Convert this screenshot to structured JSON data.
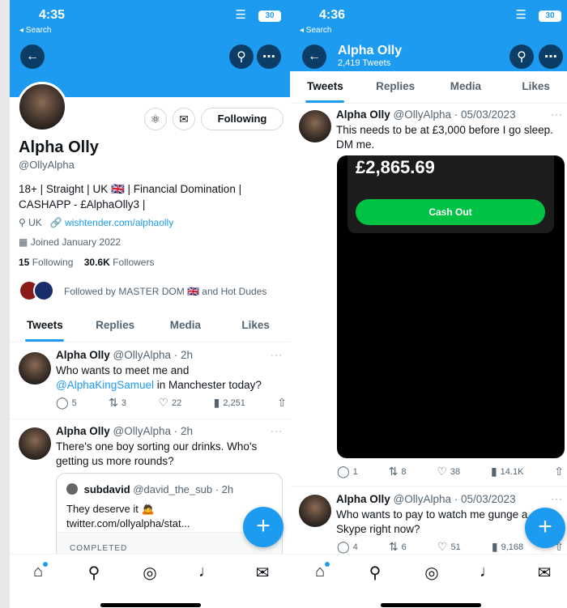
{
  "colors": {
    "brand": "#1d9bf0",
    "cash_green": "#00c244"
  },
  "left": {
    "status": {
      "time": "4:35",
      "back_app": "◂ Search",
      "battery": "30"
    },
    "profile": {
      "name": "Alpha Olly",
      "handle": "@OllyAlpha",
      "follow_button": "Following",
      "bio_line1": "18+ | Straight | UK 🇬🇧 | Financial Domination |",
      "bio_line2": "CASHAPP - £AlphaOlly3 |",
      "location": "UK",
      "website": "wishtender.com/alphaolly",
      "joined": "Joined January 2022",
      "following_count": "15",
      "following_label": "Following",
      "followers_count": "30.6K",
      "followers_label": "Followers",
      "followed_by": "Followed by MASTER DOM 🇬🇧 and Hot Dudes"
    },
    "tabs": [
      "Tweets",
      "Replies",
      "Media",
      "Likes"
    ],
    "tweets": [
      {
        "name": "Alpha Olly",
        "meta": "@OllyAlpha · 2h",
        "text_part1": "Who wants to meet me and",
        "mention": "@AlphaKingSamuel",
        "text_part2": " in Manchester today?",
        "replies": "5",
        "retweets": "3",
        "likes": "22",
        "views": "2,251"
      },
      {
        "name": "Alpha Olly",
        "meta": "@OllyAlpha · 2h",
        "text": "There's one boy sorting our drinks. Who's getting us more rounds?",
        "quote": {
          "name": "subdavid",
          "meta": "@david_the_sub · 2h",
          "text": "They deserve it 🙇 twitter.com/ollyalpha/stat...",
          "footer": "COMPLETED"
        }
      }
    ],
    "nav": [
      "home-icon",
      "search-icon",
      "spaces-icon",
      "bell-icon",
      "mail-icon"
    ]
  },
  "right": {
    "status": {
      "time": "4:36",
      "back_app": "◂ Search",
      "battery": "30"
    },
    "header": {
      "name": "Alpha Olly",
      "tweet_count": "2,419 Tweets"
    },
    "tabs": [
      "Tweets",
      "Replies",
      "Media",
      "Likes"
    ],
    "tweets": [
      {
        "name": "Alpha Olly",
        "meta": "@OllyAlpha · 05/03/2023",
        "text": "This needs to be at £3,000 before I go sleep. DM me.",
        "media_amount": "£2,865.69",
        "media_button": "Cash Out",
        "replies": "1",
        "retweets": "8",
        "likes": "38",
        "views": "14.1K"
      },
      {
        "name": "Alpha Olly",
        "meta": "@OllyAlpha · 05/03/2023",
        "text": "Who wants to pay to watch me gunge a... Skype right now?",
        "replies": "4",
        "retweets": "6",
        "likes": "51",
        "views": "9,168"
      }
    ],
    "nav": [
      "home-icon",
      "search-icon",
      "spaces-icon",
      "bell-icon",
      "mail-icon"
    ]
  }
}
